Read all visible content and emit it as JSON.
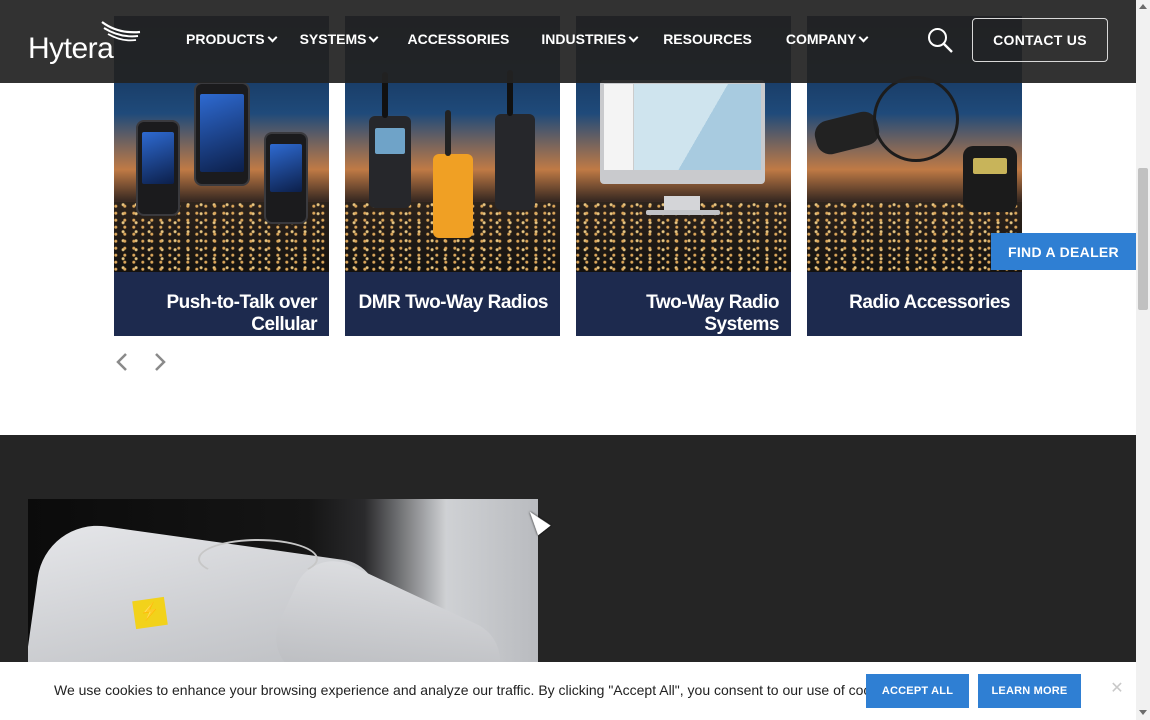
{
  "header": {
    "logo_text": "Hytera",
    "nav": [
      {
        "label": "PRODUCTS",
        "dropdown": true
      },
      {
        "label": "SYSTEMS",
        "dropdown": true
      },
      {
        "label": "ACCESSORIES",
        "dropdown": false
      },
      {
        "label": "INDUSTRIES",
        "dropdown": true
      },
      {
        "label": "RESOURCES",
        "dropdown": false
      },
      {
        "label": "COMPANY",
        "dropdown": true
      }
    ],
    "search_icon": "search-icon",
    "contact_label": "CONTACT US"
  },
  "carousel": {
    "cards": [
      {
        "title": "Push-to-Talk over Cellular"
      },
      {
        "title": "DMR Two-Way Radios"
      },
      {
        "title": "Two-Way Radio Systems"
      },
      {
        "title": "Radio Accessories"
      }
    ],
    "prev_icon": "chevron-left-icon",
    "next_icon": "chevron-right-icon"
  },
  "dealer_label": "FIND A DEALER",
  "cookie": {
    "text": "We use cookies to enhance your browsing experience and analyze our traffic. By clicking \"Accept All\", you consent to our use of cookies.",
    "accept_label": "ACCEPT ALL",
    "learn_label": "LEARN MORE"
  },
  "colors": {
    "header_bg": "#222222",
    "accent": "#2f7fd3",
    "card_bg": "#1d2a4e",
    "dark_section": "#252525"
  }
}
